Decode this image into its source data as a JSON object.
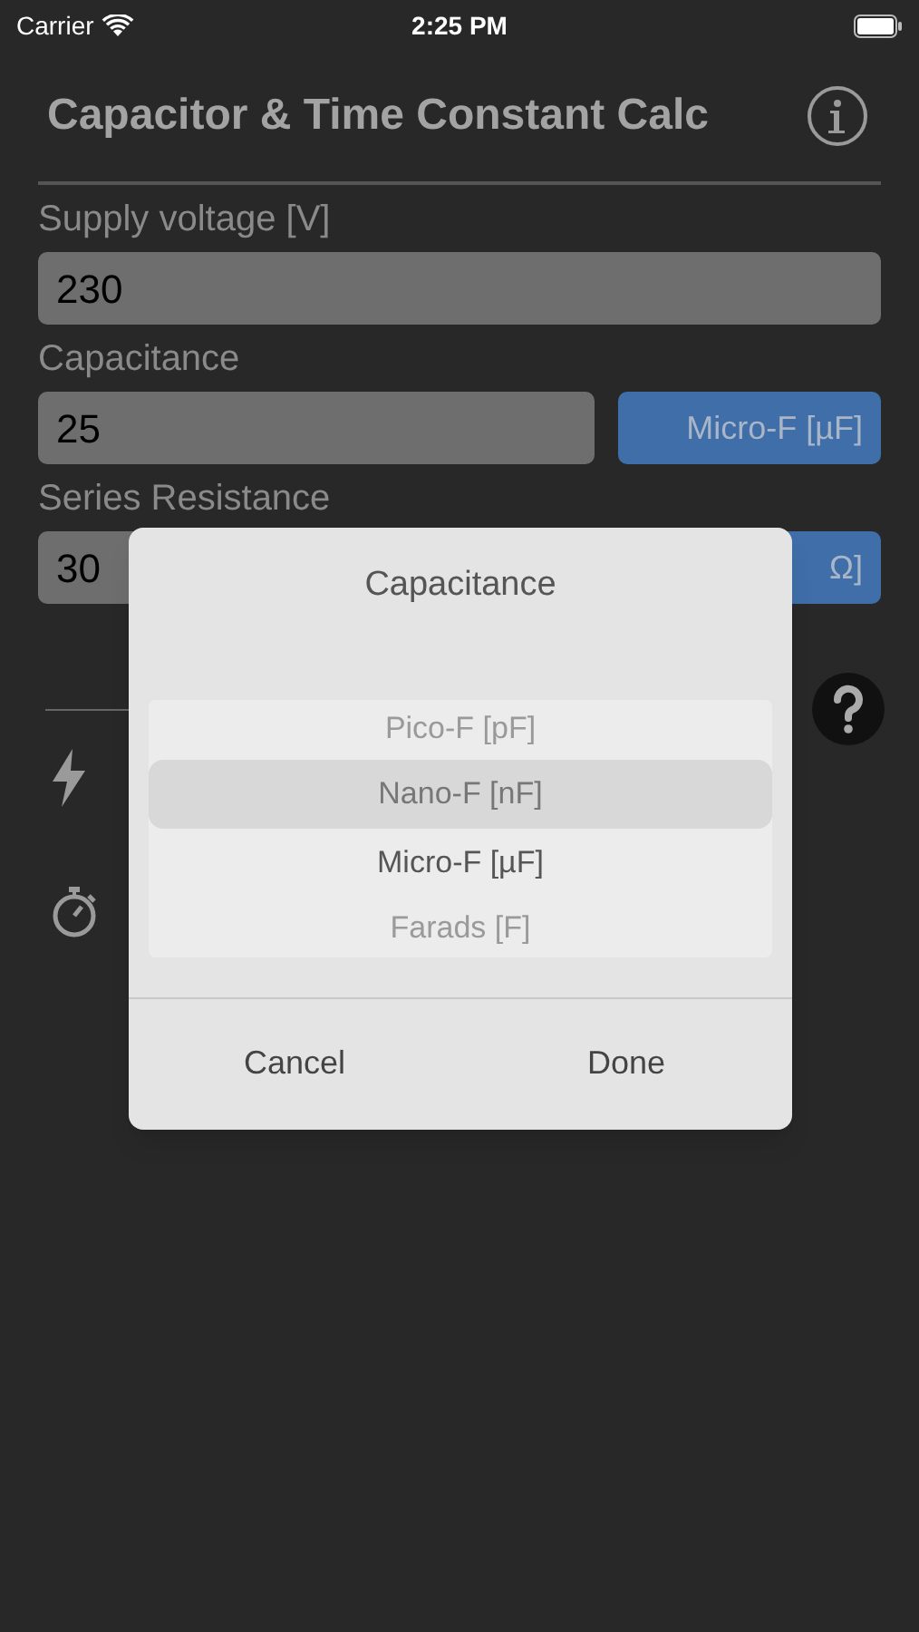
{
  "status_bar": {
    "carrier": "Carrier",
    "time": "2:25 PM"
  },
  "title": "Capacitor & Time Constant Calc",
  "fields": [
    {
      "label": "Supply voltage [V]",
      "value": "230"
    },
    {
      "label": "Capacitance",
      "value": "25",
      "unit": "Micro-F [µF]"
    },
    {
      "label": "Series Resistance",
      "value": "30",
      "unit": "Ω]"
    }
  ],
  "dialog": {
    "title": "Capacitance",
    "options": [
      {
        "label": "Pico-F [pF]",
        "selected": false
      },
      {
        "label": "Nano-F [nF]",
        "selected": true
      },
      {
        "label": "Micro-F [µF]",
        "selected": false
      },
      {
        "label": "Farads [F]",
        "selected": false
      }
    ],
    "buttons": [
      "Cancel",
      "Done"
    ]
  }
}
